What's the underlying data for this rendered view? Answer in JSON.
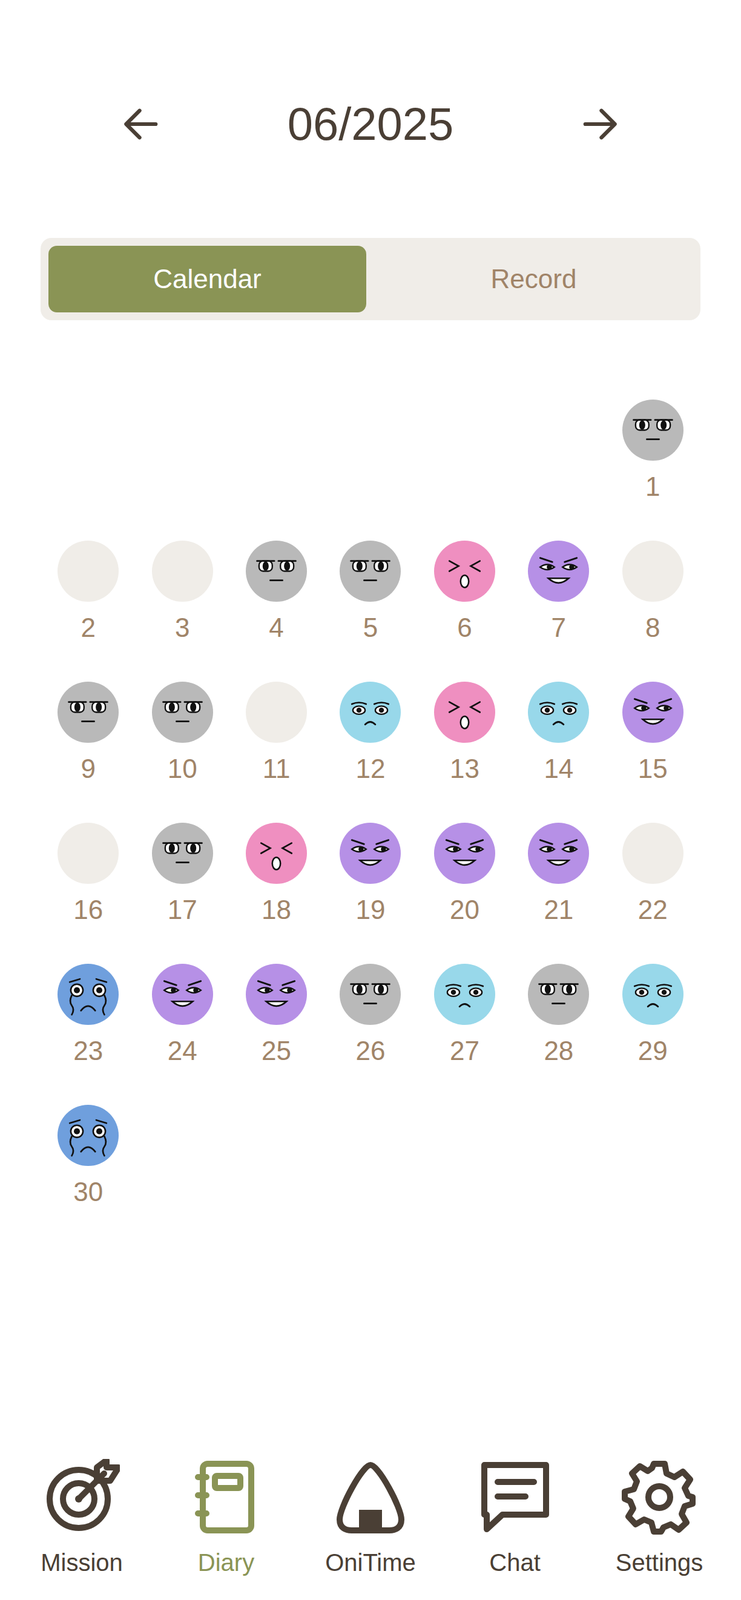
{
  "title": "06/2025",
  "view_tabs": [
    {
      "label": "Calendar",
      "selected": true
    },
    {
      "label": "Record",
      "selected": false
    }
  ],
  "days": [
    {
      "day": "1",
      "kind": "neutral",
      "color": "#b9b9b9"
    },
    {
      "day": "2",
      "kind": "empty",
      "color": "#f0ede8"
    },
    {
      "day": "3",
      "kind": "empty",
      "color": "#f0ede8"
    },
    {
      "day": "4",
      "kind": "neutral",
      "color": "#b9b9b9"
    },
    {
      "day": "5",
      "kind": "neutral",
      "color": "#b9b9b9"
    },
    {
      "day": "6",
      "kind": "angry",
      "color": "#ef8fc0"
    },
    {
      "day": "7",
      "kind": "smug",
      "color": "#b690e6"
    },
    {
      "day": "8",
      "kind": "empty",
      "color": "#f0ede8"
    },
    {
      "day": "9",
      "kind": "neutral",
      "color": "#b9b9b9"
    },
    {
      "day": "10",
      "kind": "neutral",
      "color": "#b9b9b9"
    },
    {
      "day": "11",
      "kind": "empty",
      "color": "#f0ede8"
    },
    {
      "day": "12",
      "kind": "sad",
      "color": "#98d8ea"
    },
    {
      "day": "13",
      "kind": "angry",
      "color": "#ef8fc0"
    },
    {
      "day": "14",
      "kind": "sad",
      "color": "#98d8ea"
    },
    {
      "day": "15",
      "kind": "smug",
      "color": "#b690e6"
    },
    {
      "day": "16",
      "kind": "empty",
      "color": "#f0ede8"
    },
    {
      "day": "17",
      "kind": "neutral",
      "color": "#b9b9b9"
    },
    {
      "day": "18",
      "kind": "angry",
      "color": "#ef8fc0"
    },
    {
      "day": "19",
      "kind": "smug",
      "color": "#b690e6"
    },
    {
      "day": "20",
      "kind": "smug",
      "color": "#b690e6"
    },
    {
      "day": "21",
      "kind": "smug",
      "color": "#b690e6"
    },
    {
      "day": "22",
      "kind": "empty",
      "color": "#f0ede8"
    },
    {
      "day": "23",
      "kind": "crying",
      "color": "#6f9fdd"
    },
    {
      "day": "24",
      "kind": "smug",
      "color": "#b690e6"
    },
    {
      "day": "25",
      "kind": "smug",
      "color": "#b690e6"
    },
    {
      "day": "26",
      "kind": "neutral",
      "color": "#b9b9b9"
    },
    {
      "day": "27",
      "kind": "sad",
      "color": "#98d8ea"
    },
    {
      "day": "28",
      "kind": "neutral",
      "color": "#b9b9b9"
    },
    {
      "day": "29",
      "kind": "sad",
      "color": "#98d8ea"
    },
    {
      "day": "30",
      "kind": "crying",
      "color": "#6f9fdd"
    }
  ],
  "nav": [
    {
      "label": "Mission",
      "selected": false
    },
    {
      "label": "Diary",
      "selected": true
    },
    {
      "label": "OniTime",
      "selected": false
    },
    {
      "label": "Chat",
      "selected": false
    },
    {
      "label": "Settings",
      "selected": false
    }
  ]
}
